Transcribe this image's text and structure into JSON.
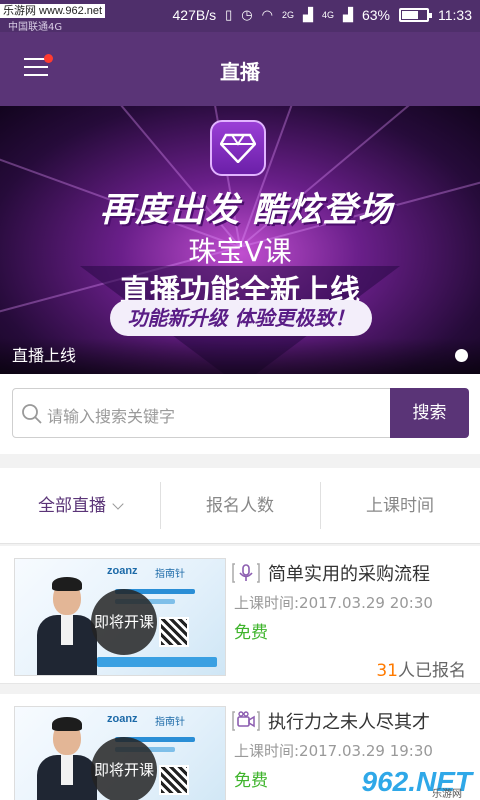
{
  "status_bar": {
    "watermark": "乐游网 www.962.net",
    "carrier": "中国联通4G",
    "speed": "427B/s",
    "net_1": "2G",
    "net_2": "4G",
    "battery": "63%",
    "battery_level": 0.63,
    "time": "11:33"
  },
  "nav": {
    "title": "直播"
  },
  "banner": {
    "line1": "再度出发 酷炫登场",
    "line2": "珠宝V课",
    "line3": "直播功能全新上线",
    "pill": "功能新升级 体验更极致！",
    "caption": "直播上线"
  },
  "search": {
    "placeholder": "请输入搜索关键字",
    "button": "搜索"
  },
  "tabs": [
    {
      "label": "全部直播"
    },
    {
      "label": "报名人数"
    },
    {
      "label": "上课时间"
    }
  ],
  "courses": [
    {
      "thumb_brand": "zoanz",
      "thumb_brand_cn": "指南针",
      "status": "即将开课",
      "title": "简单实用的采购流程",
      "time": "上课时间:2017.03.29 20:30",
      "price": "免费",
      "enroll_count": "31",
      "enroll_suffix": "人已报名",
      "icon": "microphone-icon"
    },
    {
      "thumb_brand": "zoanz",
      "thumb_brand_cn": "指南针",
      "status": "即将开课",
      "title": "执行力之未人尽其才",
      "time": "上课时间:2017.03.29 19:30",
      "price": "免费",
      "icon": "video-camera-icon"
    }
  ],
  "footer_watermark": {
    "logo": "962.NET",
    "sub": "乐游网"
  },
  "colors": {
    "brand": "#5a3477",
    "price": "#3fb42c",
    "count": "#ff7a00"
  }
}
